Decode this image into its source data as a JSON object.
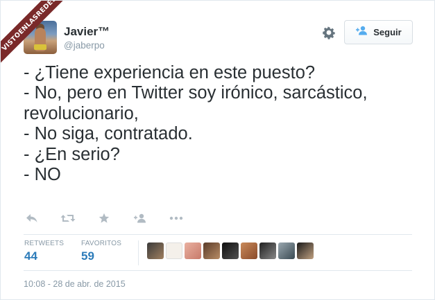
{
  "watermark": {
    "text": "VISTOENLASREDES"
  },
  "author": {
    "name": "Javier™",
    "handle": "@jaberpo",
    "avatar_icon": "profile-photo"
  },
  "header": {
    "settings_icon": "gear-icon",
    "follow_button_label": "Seguir",
    "follow_icon": "add-user-icon"
  },
  "tweet": {
    "lines": [
      "- ¿Tiene experiencia en este puesto?",
      "- No, pero en Twitter soy irónico, sarcástico,",
      "revolucionario,",
      "- No siga, contratado.",
      "- ¿En serio?",
      "- NO"
    ]
  },
  "actions": [
    {
      "name": "reply",
      "icon": "reply-icon"
    },
    {
      "name": "retweet",
      "icon": "retweet-icon"
    },
    {
      "name": "favorite",
      "icon": "star-icon"
    },
    {
      "name": "follow",
      "icon": "add-user-icon"
    },
    {
      "name": "more",
      "icon": "more-icon"
    }
  ],
  "stats": {
    "retweets_label": "RETWEETS",
    "retweets_value": "44",
    "favorites_label": "FAVORITOS",
    "favorites_value": "59"
  },
  "faces_count": 9,
  "timestamp": "10:08 - 28 de abr. de 2015",
  "colors": {
    "text": "#292f33",
    "muted": "#8899a6",
    "link": "#2b7bb9",
    "border": "#e1e8ed",
    "ribbon": "#7a2a2a"
  }
}
